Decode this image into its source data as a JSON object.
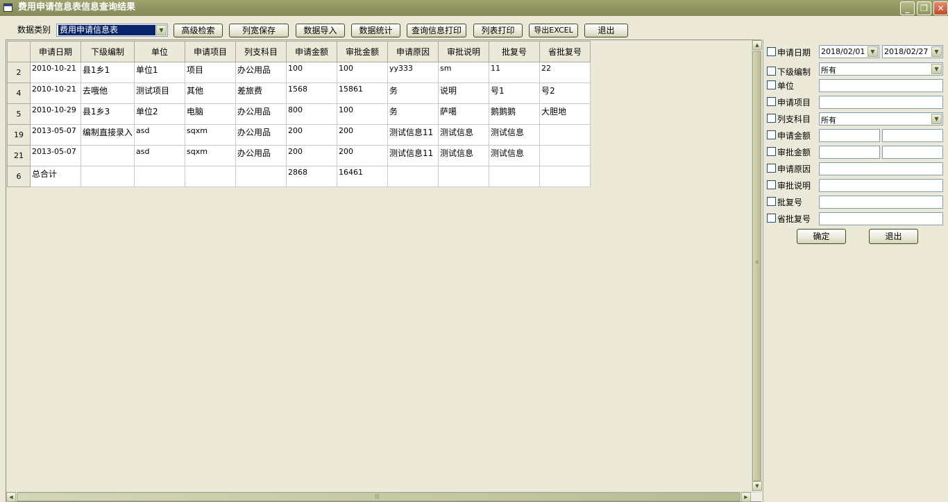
{
  "window": {
    "title": "费用申请信息表信息查询结果",
    "minimize_symbol": "_",
    "maximize_symbol": "❐",
    "close_symbol": "✕"
  },
  "toolbar": {
    "category_label": "数据类别",
    "category_value": "费用申请信息表",
    "buttons": [
      "高级检索",
      "列宽保存",
      "数据导入",
      "数据统计",
      "查询信息打印",
      "列表打印",
      "导出EXCEL",
      "退出"
    ]
  },
  "grid": {
    "columns": [
      "申请日期",
      "下级编制",
      "单位",
      "申请项目",
      "列支科目",
      "申请金额",
      "审批金额",
      "申请原因",
      "审批说明",
      "批复号",
      "省批复号"
    ],
    "rows": [
      {
        "num": "2",
        "cells": [
          "2010-10-21",
          "县1乡1",
          "单位1",
          "项目",
          "办公用品",
          "100",
          "100",
          "yy333",
          "sm",
          "11",
          "22"
        ]
      },
      {
        "num": "4",
        "cells": [
          "2010-10-21",
          "去哦他",
          "测试项目",
          "其他",
          "差旅费",
          "1568",
          "15861",
          "务",
          "说明",
          "号1",
          "号2"
        ]
      },
      {
        "num": "5",
        "cells": [
          "2010-10-29",
          "县1乡3",
          "单位2",
          "电脑",
          "办公用品",
          "800",
          "100",
          "务",
          "萨噶",
          "鹅鹅鹅",
          "大胆地"
        ]
      },
      {
        "num": "19",
        "cells": [
          "2013-05-07",
          "编制直接录入",
          "asd",
          "sqxm",
          "办公用品",
          "200",
          "200",
          "测试信息11",
          "测试信息",
          "测试信息",
          ""
        ]
      },
      {
        "num": "21",
        "cells": [
          "2013-05-07",
          "",
          "asd",
          "sqxm",
          "办公用品",
          "200",
          "200",
          "测试信息11",
          "测试信息",
          "测试信息",
          ""
        ]
      },
      {
        "num": "6",
        "cells": [
          "总合计",
          "",
          "",
          "",
          "",
          "2868",
          "16461",
          "",
          "",
          "",
          ""
        ]
      }
    ]
  },
  "filters": {
    "date_label": "申请日期",
    "date_from": "2018/02/01",
    "date_to": "2018/02/27",
    "sub_unit_label": "下级编制",
    "sub_unit_value": "所有",
    "unit_label": "单位",
    "project_label": "申请项目",
    "subject_label": "列支科目",
    "subject_value": "所有",
    "apply_amount_label": "申请金额",
    "approve_amount_label": "审批金额",
    "reason_label": "申请原因",
    "approve_note_label": "审批说明",
    "reply_no_label": "批复号",
    "prov_reply_no_label": "省批复号",
    "ok_label": "确定",
    "exit_label": "退出"
  }
}
